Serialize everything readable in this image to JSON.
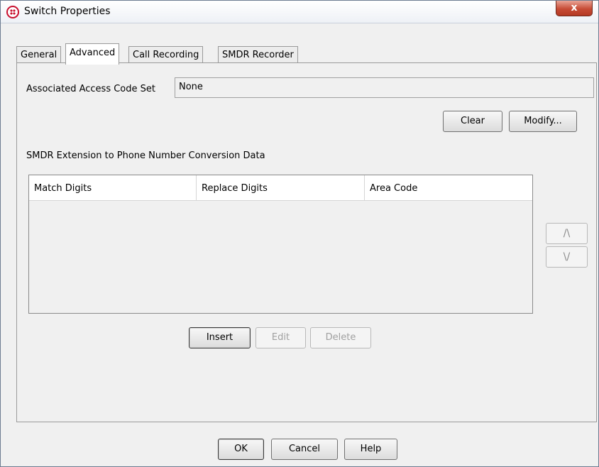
{
  "window": {
    "title": "Switch Properties",
    "close_glyph": "x"
  },
  "tabs": [
    {
      "label": "General",
      "active": false
    },
    {
      "label": "Advanced",
      "active": true
    },
    {
      "label": "Call Recording",
      "active": false
    },
    {
      "label": "SMDR Recorder",
      "active": false
    }
  ],
  "access_code": {
    "label": "Associated Access Code Set",
    "value": "None"
  },
  "access_buttons": {
    "clear": "Clear",
    "modify": "Modify..."
  },
  "smdr": {
    "section_label": "SMDR Extension to Phone Number Conversion Data",
    "columns": [
      "Match Digits",
      "Replace Digits",
      "Area Code"
    ],
    "rows": []
  },
  "move_buttons": {
    "up": "/\\",
    "down": "\\/"
  },
  "table_buttons": {
    "insert": "Insert",
    "edit": "Edit",
    "delete": "Delete"
  },
  "dialog_buttons": {
    "ok": "OK",
    "cancel": "Cancel",
    "help": "Help"
  },
  "colors": {
    "close_button": "#c74c36",
    "window_bg": "#f0f0f0",
    "app_icon": "#c8102e"
  }
}
